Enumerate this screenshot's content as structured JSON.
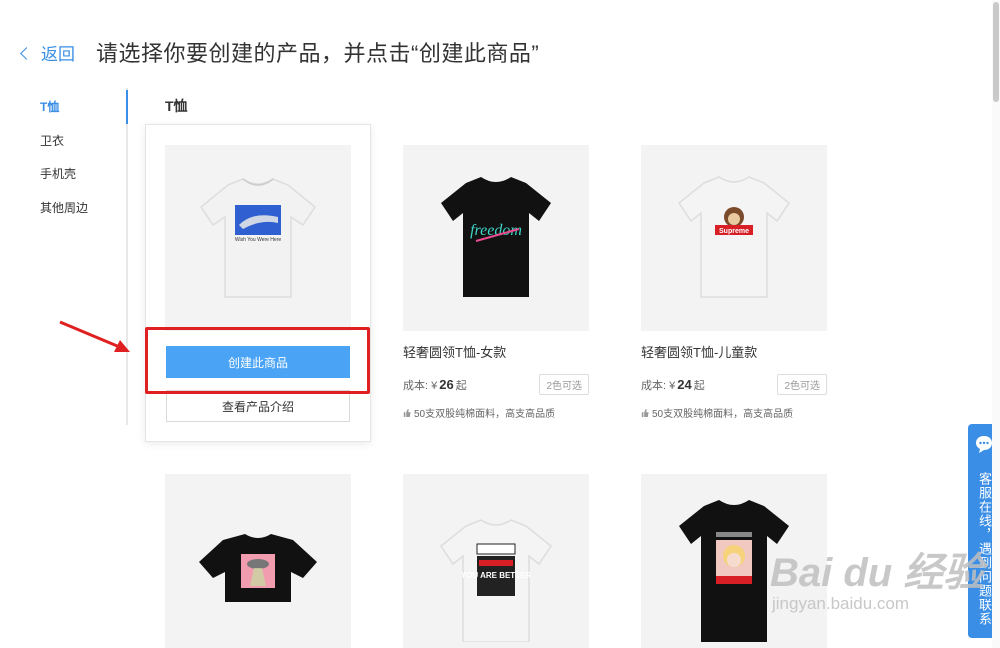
{
  "header": {
    "back_label": "返回",
    "title": "请选择你要创建的产品，并点击“创建此商品”"
  },
  "sidebar": {
    "items": [
      {
        "label": "T恤",
        "active": true
      },
      {
        "label": "卫衣"
      },
      {
        "label": "手机壳"
      },
      {
        "label": "其他周边"
      }
    ]
  },
  "section": {
    "title": "T恤"
  },
  "hover_card": {
    "create_label": "创建此商品",
    "intro_label": "查看产品介绍"
  },
  "products": [
    {
      "name": "轻奢圆领T恤-女款",
      "cost_label": "成本:",
      "price_prefix": "¥",
      "price": "26",
      "price_suffix": "起",
      "colors": "2色可选",
      "feature": "50支双股纯棉面料，高支高品质",
      "shirt_color": "#111111",
      "print_text": "freedom"
    },
    {
      "name": "轻奢圆领T恤-儿童款",
      "cost_label": "成本:",
      "price_prefix": "¥",
      "price": "24",
      "price_suffix": "起",
      "colors": "2色可选",
      "feature": "50支双股纯棉面料，高支高品质",
      "shirt_color": "#f4f4f4",
      "print_text": "Supreme"
    }
  ],
  "first_product": {
    "print_text": "Wish You Were Here"
  },
  "row2": [
    {
      "shirt_color": "#111111"
    },
    {
      "shirt_color": "#f4f4f4",
      "print_text": "YOU ARE BETTER"
    },
    {
      "shirt_color": "#111111"
    }
  ],
  "service": {
    "label": "客服在线，遇到问题联系"
  },
  "watermark": {
    "top": "Bai du 经验",
    "bottom": "jingyan.baidu.com"
  },
  "colors": {
    "accent": "#3a8ee6",
    "button": "#4aa3f5",
    "highlight": "#e02020"
  }
}
